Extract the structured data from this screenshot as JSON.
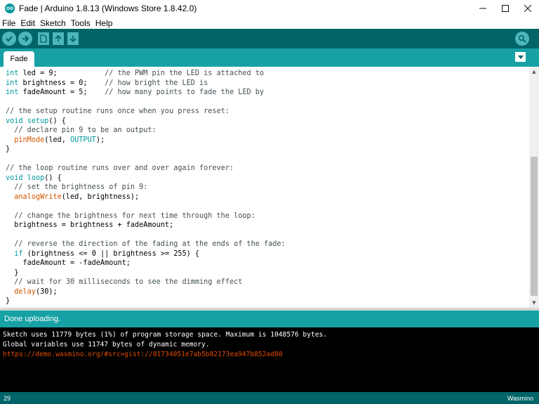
{
  "window": {
    "title": "Fade | Arduino 1.8.13 (Windows Store 1.8.42.0)",
    "icon_label": "OO"
  },
  "menu": [
    "File",
    "Edit",
    "Sketch",
    "Tools",
    "Help"
  ],
  "toolbar": {
    "buttons": [
      "verify-icon",
      "upload-icon",
      "new-icon",
      "open-icon",
      "save-icon"
    ],
    "serial_monitor": "serial-monitor-icon"
  },
  "tabs": [
    {
      "label": "Fade"
    }
  ],
  "editor": {
    "lines": [
      [
        {
          "t": "int",
          "c": "kw"
        },
        {
          "t": " led = 9;           "
        },
        {
          "t": "// the PWM pin the LED is attached to",
          "c": "cm"
        }
      ],
      [
        {
          "t": "int",
          "c": "kw"
        },
        {
          "t": " brightness = 0;    "
        },
        {
          "t": "// how bright the LED is",
          "c": "cm"
        }
      ],
      [
        {
          "t": "int",
          "c": "kw"
        },
        {
          "t": " fadeAmount = 5;    "
        },
        {
          "t": "// how many points to fade the LED by",
          "c": "cm"
        }
      ],
      [],
      [
        {
          "t": "// the setup routine runs once when you press reset:",
          "c": "cm"
        }
      ],
      [
        {
          "t": "void",
          "c": "kw"
        },
        {
          "t": " "
        },
        {
          "t": "setup",
          "c": "kw"
        },
        {
          "t": "() {"
        }
      ],
      [
        {
          "t": "  "
        },
        {
          "t": "// declare pin 9 to be an output:",
          "c": "cm"
        }
      ],
      [
        {
          "t": "  "
        },
        {
          "t": "pinMode",
          "c": "fn"
        },
        {
          "t": "(led, "
        },
        {
          "t": "OUTPUT",
          "c": "kw"
        },
        {
          "t": ");"
        }
      ],
      [
        {
          "t": "}"
        }
      ],
      [],
      [
        {
          "t": "// the loop routine runs over and over again forever:",
          "c": "cm"
        }
      ],
      [
        {
          "t": "void",
          "c": "kw"
        },
        {
          "t": " "
        },
        {
          "t": "loop",
          "c": "kw"
        },
        {
          "t": "() {"
        }
      ],
      [
        {
          "t": "  "
        },
        {
          "t": "// set the brightness of pin 9:",
          "c": "cm"
        }
      ],
      [
        {
          "t": "  "
        },
        {
          "t": "analogWrite",
          "c": "fn"
        },
        {
          "t": "(led, brightness);"
        }
      ],
      [],
      [
        {
          "t": "  "
        },
        {
          "t": "// change the brightness for next time through the loop:",
          "c": "cm"
        }
      ],
      [
        {
          "t": "  brightness = brightness + fadeAmount;"
        }
      ],
      [],
      [
        {
          "t": "  "
        },
        {
          "t": "// reverse the direction of the fading at the ends of the fade:",
          "c": "cm"
        }
      ],
      [
        {
          "t": "  "
        },
        {
          "t": "if",
          "c": "kw"
        },
        {
          "t": " (brightness <= 0 || brightness >= 255) {"
        }
      ],
      [
        {
          "t": "    fadeAmount = -fadeAmount;"
        }
      ],
      [
        {
          "t": "  }"
        }
      ],
      [
        {
          "t": "  "
        },
        {
          "t": "// wait for 30 milliseconds to see the dimming effect",
          "c": "cm"
        }
      ],
      [
        {
          "t": "  "
        },
        {
          "t": "delay",
          "c": "fn"
        },
        {
          "t": "(30);"
        }
      ],
      [
        {
          "t": "}"
        }
      ]
    ]
  },
  "status": {
    "message": "Done uploading."
  },
  "console": {
    "line1": "Sketch uses 11779 bytes (1%) of program storage space. Maximum is 1048576 bytes.",
    "line2": "Global variables use 11747 bytes of dynamic memory.",
    "url": "https://demo.wasmino.org/#src=gist://01734051e7ab5b82173ea947b852ad80"
  },
  "footer": {
    "line_number": "29",
    "board": "Wasmino"
  },
  "colors": {
    "toolbar": "#006468",
    "tabbar": "#17a1a5",
    "keyword": "#00979d",
    "function": "#d35400"
  }
}
